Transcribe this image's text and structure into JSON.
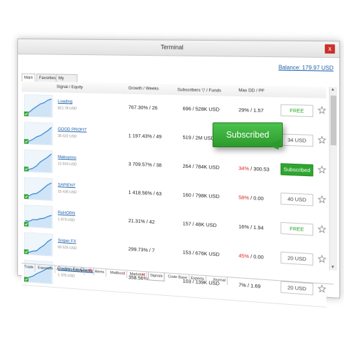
{
  "window": {
    "title": "Terminal"
  },
  "account": {
    "balance": "Balance: 179.97 USD"
  },
  "top_tabs": [
    "Main",
    "Favorites",
    "My Statistics"
  ],
  "columns": {
    "signal": "Signal / Equity",
    "growth": "Growth / Weeks",
    "subscribers": "Subscribers ▽ / Funds",
    "maxdd": "Max DD / PF"
  },
  "signals": [
    {
      "name": "Loading",
      "equity": "821.78 USD",
      "growth": "767.30% / 26",
      "subs": "696 / 528K USD",
      "maxdd": "29% / 1.57",
      "maxdd_red": "",
      "action": "FREE",
      "type": "free"
    },
    {
      "name": "GOOD PROFIT",
      "equity": "35 622 USD",
      "growth": "1 197.43% / 49",
      "subs": "519 / 2M USD",
      "maxdd": "",
      "maxdd_red": "",
      "action": "34 USD",
      "type": "usd"
    },
    {
      "name": "Makuyoss",
      "equity": "12 810 USD",
      "growth": "3 709.57% / 38",
      "subs": "264 / 784K USD",
      "maxdd": " / 300.53",
      "maxdd_red": "34%",
      "action": "Subscribed",
      "type": "sub"
    },
    {
      "name": "SAPIENT",
      "equity": "15 435 USD",
      "growth": "1 418.56% / 63",
      "subs": "160 / 798K USD",
      "maxdd": " / 0.00",
      "maxdd_red": "58%",
      "action": "40 USD",
      "type": "usd"
    },
    {
      "name": "ReHORN",
      "equity": "1 873 USD",
      "growth": "21.31% / 42",
      "subs": "157 / 48K USD",
      "maxdd": "16% / 1.94",
      "maxdd_red": "",
      "action": "FREE",
      "type": "free"
    },
    {
      "name": "Sniper FX",
      "equity": "60 525 USD",
      "growth": "299.73% / 7",
      "subs": "153 / 676K USD",
      "maxdd": " / 0.00",
      "maxdd_red": "45%",
      "action": "20 USD",
      "type": "usd"
    },
    {
      "name": "Trading For Charity",
      "equity": "1 376 USD",
      "growth": "358.56% / 21",
      "subs": "103 / 139K USD",
      "maxdd": "7% / 1.69",
      "maxdd_red": "",
      "action": "20 USD",
      "type": "usd"
    }
  ],
  "bottom_tabs": [
    {
      "label": "Trade",
      "count": ""
    },
    {
      "label": "Exposure",
      "count": ""
    },
    {
      "label": "Account History",
      "count": ""
    },
    {
      "label": "News",
      "count": "99"
    },
    {
      "label": "Alerts",
      "count": ""
    },
    {
      "label": "Mailbox",
      "count": "3"
    },
    {
      "label": "Market",
      "count": "44"
    },
    {
      "label": "Signals",
      "count": ""
    },
    {
      "label": "Code Base",
      "count": ""
    },
    {
      "label": "Experts",
      "count": ""
    },
    {
      "label": "Journal",
      "count": ""
    }
  ],
  "active_bottom_tab": "Signals",
  "callout": {
    "label": "Subscribed"
  },
  "colors": {
    "accent_green": "#2fa52f",
    "link_blue": "#1b5fa8",
    "drawdown_red": "#e02020"
  },
  "icons": [
    "close-icon",
    "star-icon",
    "sort-arrow-icon",
    "equity-chart-icon",
    "check-icon"
  ]
}
